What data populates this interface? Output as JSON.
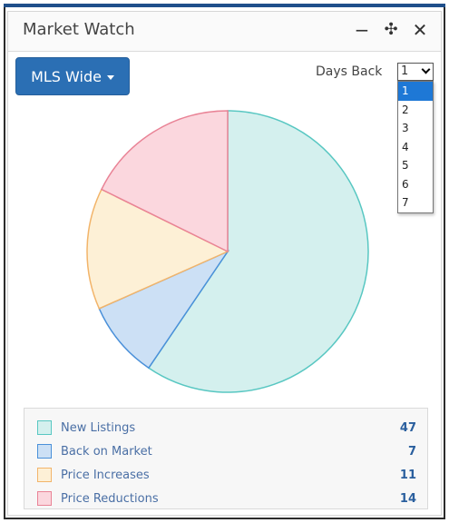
{
  "window": {
    "title": "Market Watch",
    "icons": {
      "minimize": "−",
      "move": "✣",
      "close": "✕"
    }
  },
  "toolbar": {
    "scope_button": "MLS Wide",
    "days_back_label": "Days Back",
    "days_back_selected": "1",
    "days_back_options": [
      "1",
      "2",
      "3",
      "4",
      "5",
      "6",
      "7"
    ]
  },
  "chart_data": {
    "type": "pie",
    "categories": [
      "New Listings",
      "Back on Market",
      "Price Increases",
      "Price Reductions"
    ],
    "values": [
      47,
      7,
      11,
      14
    ],
    "colors": {
      "fill": [
        "#d4f0ee",
        "#cce0f5",
        "#fdf0d6",
        "#fbd7de"
      ],
      "stroke": [
        "#58c7c2",
        "#4a90d9",
        "#f2b46a",
        "#e98396"
      ]
    },
    "legend_position": "bottom"
  }
}
